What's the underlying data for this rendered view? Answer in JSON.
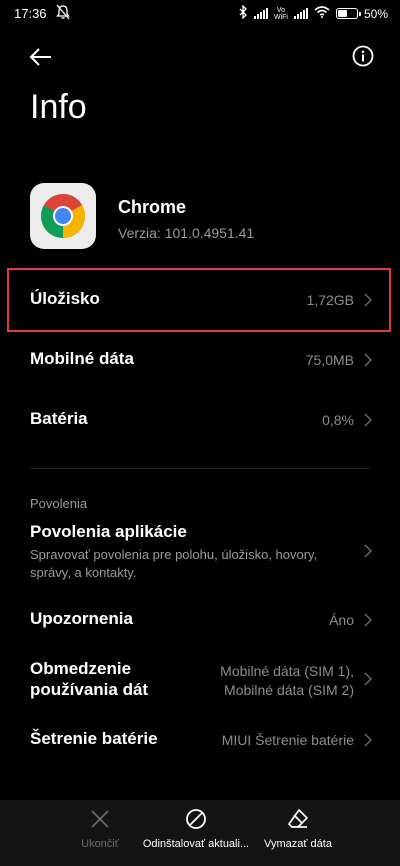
{
  "status_bar": {
    "time": "17:36",
    "volte_top": "Vo",
    "volte_bottom": "WiFi",
    "battery": "50%"
  },
  "page": {
    "title": "Info"
  },
  "app": {
    "name": "Chrome",
    "version": "Verzia: 101.0.4951.41"
  },
  "rows": {
    "storage": {
      "label": "Úložisko",
      "value": "1,72GB"
    },
    "mobile_data": {
      "label": "Mobilné dáta",
      "value": "75,0MB"
    },
    "battery": {
      "label": "Batéria",
      "value": "0,8%"
    }
  },
  "permissions_section": {
    "header": "Povolenia",
    "app_permissions": {
      "label": "Povolenia aplikácie",
      "description": "Spravovať povolenia pre polohu, úložisko, hovory, správy, a kontakty."
    },
    "notifications": {
      "label": "Upozornenia",
      "value": "Áno"
    },
    "data_usage": {
      "label_line1": "Obmedzenie",
      "label_line2": "používania dát",
      "value_line1": "Mobilné dáta (SIM 1),",
      "value_line2": "Mobilné dáta (SIM 2)"
    },
    "battery_saver": {
      "label": "Šetrenie batérie",
      "value": "MIUI Šetrenie batérie"
    }
  },
  "bottom_bar": {
    "force_stop": "Ukončiť",
    "uninstall_updates": "Odinštalovať aktuali...",
    "clear_data": "Vymazať dáta"
  },
  "colors": {
    "highlight": "#e23b3b",
    "background": "#000000",
    "secondary_text": "#8d8d8d"
  }
}
